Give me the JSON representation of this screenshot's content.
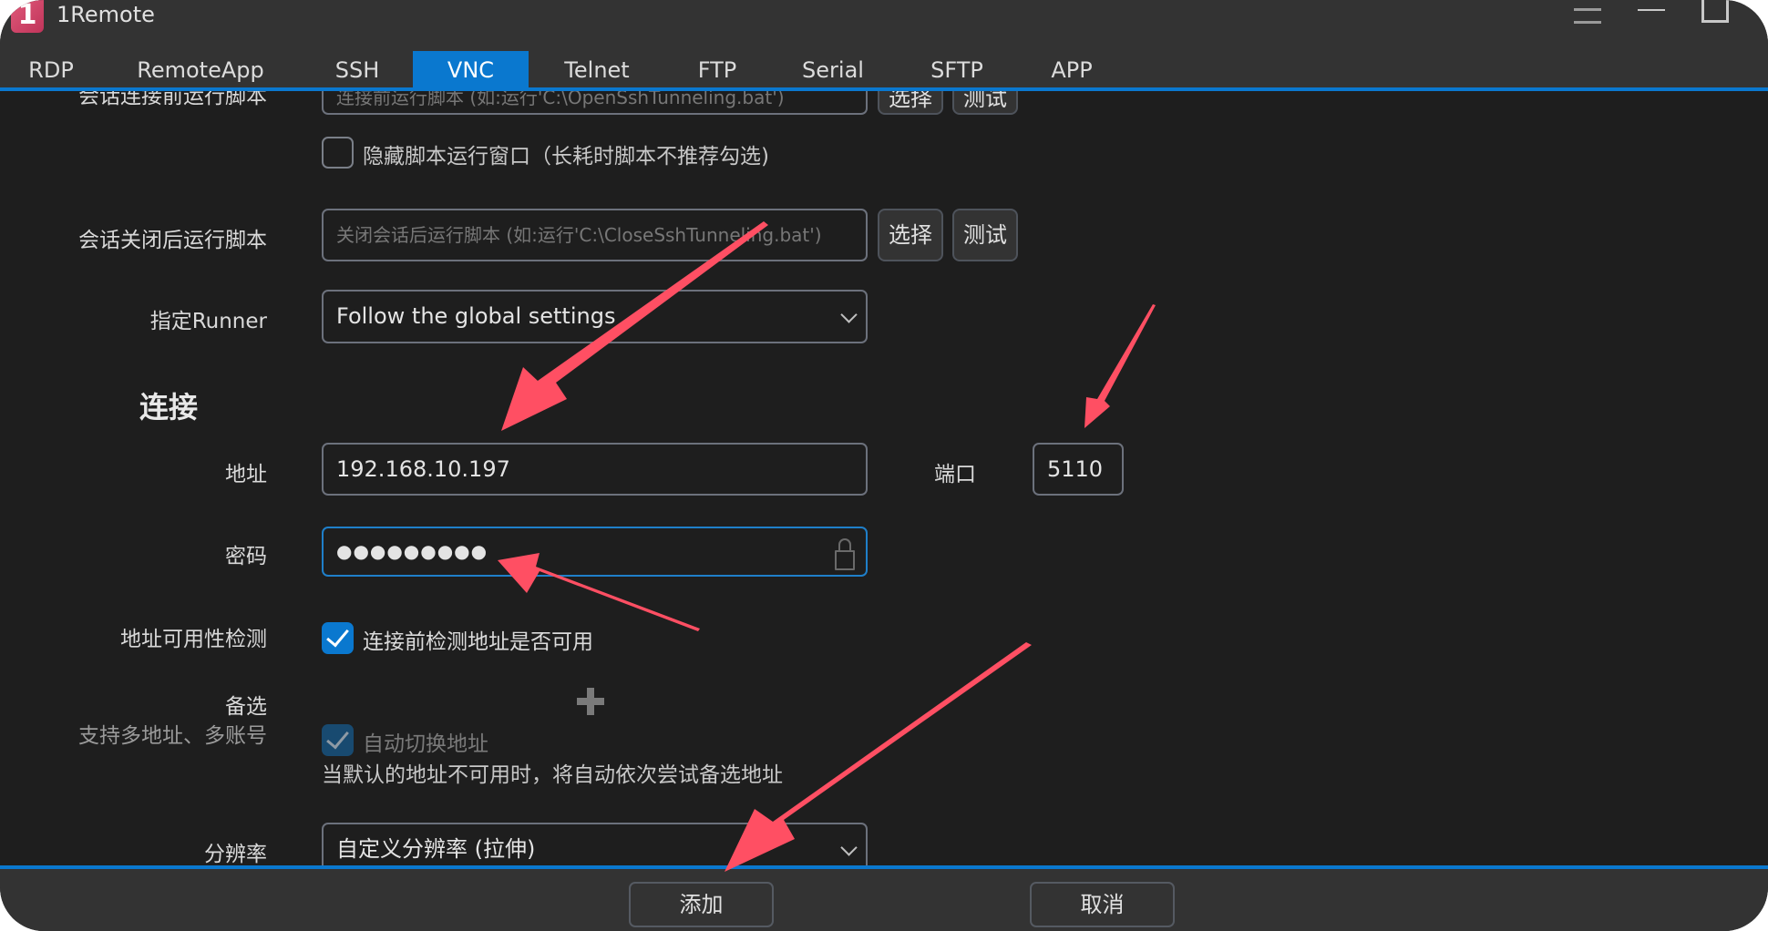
{
  "window": {
    "title": "1Remote",
    "logo_text": "1",
    "controls": [
      "menu-icon",
      "minimize-icon",
      "maximize-icon"
    ]
  },
  "tabs": [
    {
      "label": "RDP",
      "active": false
    },
    {
      "label": "RemoteApp",
      "active": false
    },
    {
      "label": "SSH",
      "active": false
    },
    {
      "label": "VNC",
      "active": true
    },
    {
      "label": "Telnet",
      "active": false
    },
    {
      "label": "FTP",
      "active": false
    },
    {
      "label": "Serial",
      "active": false
    },
    {
      "label": "SFTP",
      "active": false
    },
    {
      "label": "APP",
      "active": false
    }
  ],
  "form": {
    "pre_script": {
      "label": "会话连接前运行脚本",
      "placeholder": "连接前运行脚本 (如:运行'C:\\OpenSshTunneling.bat')",
      "select_label": "选择",
      "test_label": "测试"
    },
    "hide_script_window": {
      "label": "隐藏脚本运行窗口（长耗时脚本不推荐勾选)",
      "checked": false
    },
    "post_script": {
      "label": "会话关闭后运行脚本",
      "placeholder": "关闭会话后运行脚本 (如:运行'C:\\CloseSshTunneling.bat')",
      "select_label": "选择",
      "test_label": "测试"
    },
    "runner": {
      "label": "指定Runner",
      "value": "Follow the global settings"
    },
    "section_connection": "连接",
    "address": {
      "label": "地址",
      "value": "192.168.10.197"
    },
    "port": {
      "label": "端口",
      "value": "5110"
    },
    "password": {
      "label": "密码",
      "value": "●●●●●●●●●"
    },
    "availability_check": {
      "label": "地址可用性检测",
      "checkbox_label": "连接前检测地址是否可用",
      "checked": true
    },
    "alternates": {
      "label": "备选",
      "sublabel": "支持多地址、多账号",
      "auto_switch_label": "自动切换地址",
      "auto_switch_checked": true,
      "auto_switch_disabled": true,
      "description": "当默认的地址不可用时，将自动依次尝试备选地址"
    },
    "resolution": {
      "label": "分辨率",
      "value": "自定义分辨率 (拉伸)"
    }
  },
  "footer": {
    "add_label": "添加",
    "cancel_label": "取消"
  },
  "annotations": {
    "arrow_color": "#ff4f63"
  }
}
